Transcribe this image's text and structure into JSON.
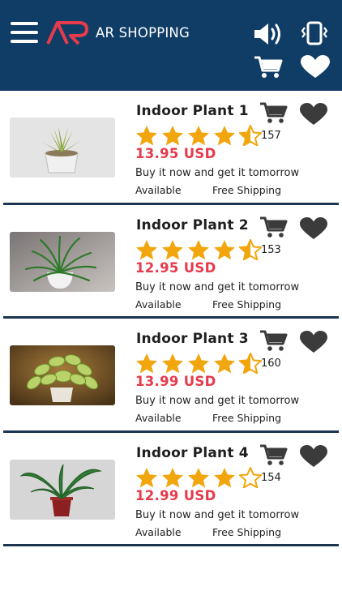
{
  "header": {
    "brand": "AR SHOPPING",
    "menu_icon": "hamburger-menu-icon",
    "sound_icon": "speaker-icon",
    "vibrate_icon": "phone-vibrate-icon",
    "cart_icon": "shopping-cart-icon",
    "favorites_icon": "heart-icon",
    "background_color": "#0f3d66"
  },
  "colors": {
    "price": "#e63b4c",
    "star": "#f2a60d",
    "divider": "#1c3550",
    "icon_dark": "#3b3b3b"
  },
  "products": [
    {
      "title": "Indoor Plant 1",
      "rating": 4.5,
      "rating_count": "157",
      "price": "13.95 USD",
      "promo": "Buy it now and get it tomorrow",
      "availability": "Available",
      "shipping": "Free Shipping",
      "image": "succulent-in-white-pot"
    },
    {
      "title": "Indoor Plant 2",
      "rating": 4.5,
      "rating_count": "153",
      "price": "12.95 USD",
      "promo": "Buy it now and get it tomorrow",
      "availability": "Available",
      "shipping": "Free Shipping",
      "image": "spider-plant-in-white-pot"
    },
    {
      "title": "Indoor Plant 3",
      "rating": 4.5,
      "rating_count": "160",
      "price": "13.99 USD",
      "promo": "Buy it now and get it tomorrow",
      "availability": "Available",
      "shipping": "Free Shipping",
      "image": "pothos-in-white-pot"
    },
    {
      "title": "Indoor Plant 4",
      "rating": 4,
      "rating_count": "154",
      "price": "12.99 USD",
      "promo": "Buy it now and get it tomorrow",
      "availability": "Available",
      "shipping": "Free Shipping",
      "image": "banana-plant-in-red-pot"
    }
  ]
}
